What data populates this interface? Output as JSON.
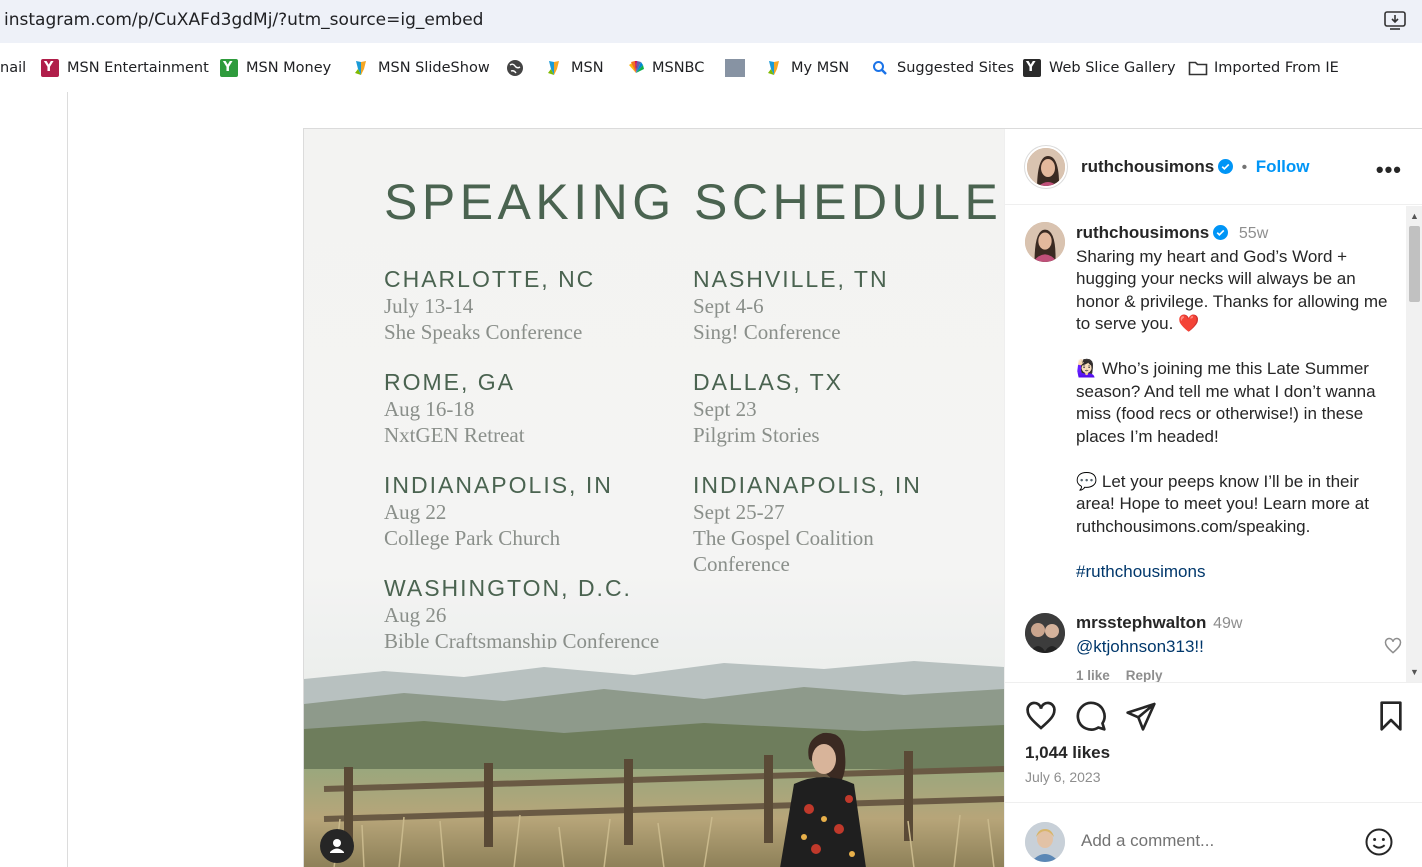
{
  "browser": {
    "url": "instagram.com/p/CuXAFd3gdMj/?utm_source=ig_embed",
    "favorites": [
      {
        "label": "nail"
      },
      {
        "label": "MSN Entertainment"
      },
      {
        "label": "MSN Money"
      },
      {
        "label": "MSN SlideShow"
      },
      {
        "label": ""
      },
      {
        "label": "MSN"
      },
      {
        "label": "MSNBC"
      },
      {
        "label": ""
      },
      {
        "label": "My MSN"
      },
      {
        "label": "Suggested Sites"
      },
      {
        "label": "Web Slice Gallery"
      },
      {
        "label": "Imported From IE"
      }
    ]
  },
  "post_image": {
    "title": "SPEAKING SCHEDULE",
    "events": [
      {
        "city": "CHARLOTTE, NC",
        "date": "July 13-14",
        "venue": "She Speaks Conference"
      },
      {
        "city": "NASHVILLE, TN",
        "date": "Sept 4-6",
        "venue": "Sing! Conference"
      },
      {
        "city": "ROME, GA",
        "date": "Aug 16-18",
        "venue": "NxtGEN Retreat"
      },
      {
        "city": "DALLAS, TX",
        "date": "Sept 23",
        "venue": "Pilgrim Stories"
      },
      {
        "city": "INDIANAPOLIS, IN",
        "date": "Aug 22",
        "venue": "College Park Church"
      },
      {
        "city": "INDIANAPOLIS, IN",
        "date": "Sept 25-27",
        "venue": "The Gospel Coalition Conference"
      },
      {
        "city": "WASHINGTON, D.C.",
        "date": "Aug 26",
        "venue": "Bible Craftsmanship Conference"
      }
    ]
  },
  "side": {
    "username": "ruthchousimons",
    "follow": "Follow",
    "separator": "•",
    "more": "•••",
    "caption": {
      "username": "ruthchousimons",
      "time": "55w",
      "p1": "Sharing my heart and God’s Word + hugging your necks will always be an honor & privilege. Thanks for allowing me to serve you. ❤️",
      "p2": "🙋🏻‍♀️ Who’s joining me this Late Summer season? And tell me what I don’t wanna miss (food recs or otherwise!) in these places I’m headed!",
      "p3": "💬 Let your peeps know I’ll be in their area! Hope to meet you! Learn more at ruthchousimons.com/speaking.",
      "hashtag": "#ruthchousimons"
    },
    "comment": {
      "username": "mrsstephwalton",
      "time": "49w",
      "text": "@ktjohnson313!!",
      "likes": "1 like",
      "reply": "Reply"
    },
    "likes": "1,044 likes",
    "date": "July 6, 2023",
    "add_comment_placeholder": "Add a comment..."
  },
  "colors": {
    "schedule_green": "#4a6350",
    "link_blue": "#0095f6",
    "heart_red": "#ed1c24"
  }
}
